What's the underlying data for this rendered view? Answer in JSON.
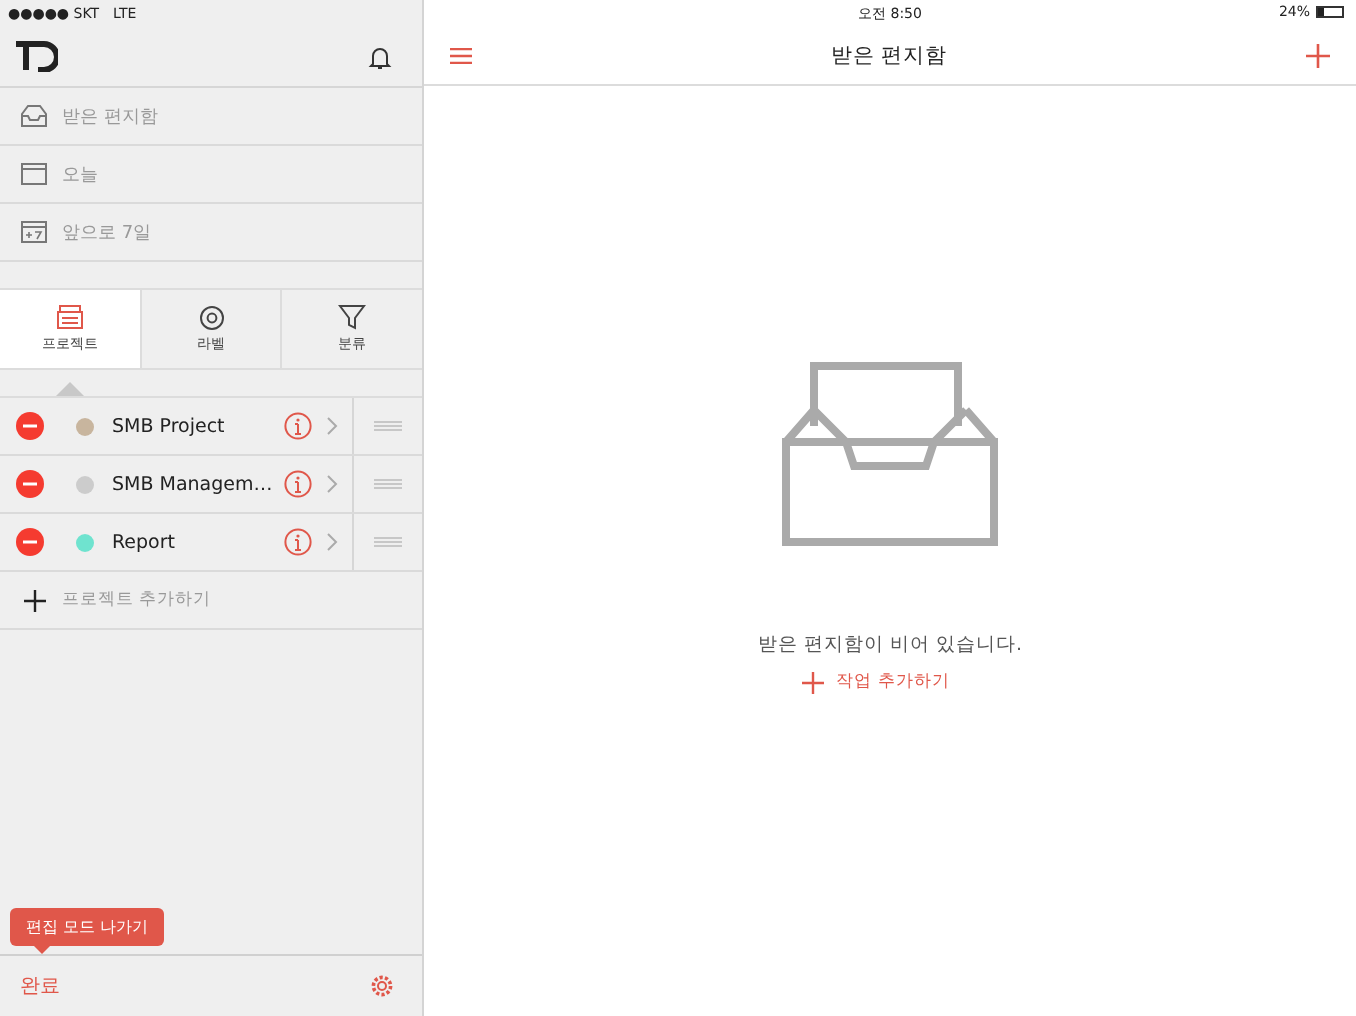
{
  "status_bar": {
    "carrier": "●●●●● SKT",
    "network": "LTE",
    "time": "오전 8:50",
    "battery": "24%"
  },
  "sidebar": {
    "nav": [
      {
        "label": "받은 편지함",
        "kind": "inbox"
      },
      {
        "label": "오늘",
        "kind": "today"
      },
      {
        "label": "앞으로 7일",
        "kind": "week"
      }
    ],
    "tabs": [
      {
        "label": "프로젝트",
        "kind": "projects",
        "selected": true
      },
      {
        "label": "라벨",
        "kind": "labels",
        "selected": false
      },
      {
        "label": "분류",
        "kind": "filters",
        "selected": false
      }
    ],
    "projects": [
      {
        "name": "SMB Project",
        "color": "#c8b59e"
      },
      {
        "name": "SMB Managem…",
        "color": "#cccccc"
      },
      {
        "name": "Report",
        "color": "#6fe3cf"
      }
    ],
    "add_project": "프로젝트 추가하기",
    "tooltip": "편집 모드 나가기",
    "done": "완료"
  },
  "main": {
    "title": "받은 편지함",
    "empty_message": "받은 편지함이 비어 있습니다.",
    "add_task": "작업 추가하기"
  }
}
